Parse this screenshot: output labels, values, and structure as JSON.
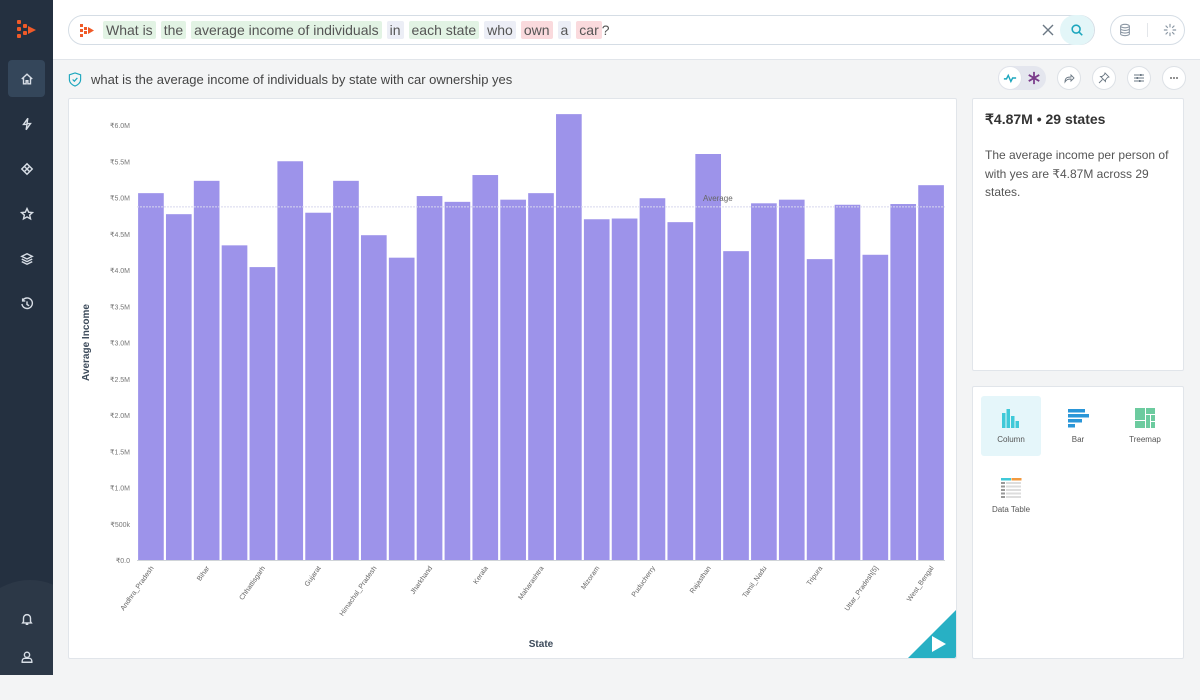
{
  "search": {
    "tokens": [
      {
        "text": "What is",
        "kind": "green"
      },
      {
        "text": "the",
        "kind": "green"
      },
      {
        "text": "average income of individuals",
        "kind": "green"
      },
      {
        "text": "in",
        "kind": "grey"
      },
      {
        "text": "each state",
        "kind": "green"
      },
      {
        "text": "who",
        "kind": "grey"
      },
      {
        "text": "own",
        "kind": "red"
      },
      {
        "text": "a",
        "kind": "grey"
      },
      {
        "text": "car",
        "kind": "red"
      },
      {
        "text": "?",
        "kind": "plain"
      }
    ]
  },
  "interpreted_query": "what is the average income of individuals by state with car ownership yes",
  "summary": {
    "headline": "₹4.87M • 29 states",
    "description": "The average income per person of with yes are ₹4.87M across 29 states."
  },
  "viz_options": [
    {
      "label": "Column",
      "icon": "column-chart-icon",
      "active": true
    },
    {
      "label": "Bar",
      "icon": "bar-chart-icon",
      "active": false
    },
    {
      "label": "Treemap",
      "icon": "treemap-icon",
      "active": false
    },
    {
      "label": "Data Table",
      "icon": "data-table-icon",
      "active": false
    }
  ],
  "colors": {
    "bar": "#9d93ea",
    "accent": "#28b0c4",
    "brand": "#f05a28",
    "sidebar": "#243040"
  },
  "chart_data": {
    "type": "bar",
    "title": "",
    "xlabel": "State",
    "ylabel": "Average Income",
    "ylim": [
      0,
      6000000
    ],
    "yticks": [
      0,
      500000,
      1000000,
      1500000,
      2000000,
      2500000,
      3000000,
      3500000,
      4000000,
      4500000,
      5000000,
      5500000,
      6000000
    ],
    "ytick_labels": [
      "₹0.0",
      "₹500k",
      "₹1.0M",
      "₹1.5M",
      "₹2.0M",
      "₹2.5M",
      "₹3.0M",
      "₹3.5M",
      "₹4.0M",
      "₹4.5M",
      "₹5.0M",
      "₹5.5M",
      "₹6.0M"
    ],
    "categories": [
      "Andhra_Pradesh",
      "",
      "Bihar",
      "",
      "Chhattisgarh",
      "",
      "Gujarat",
      "",
      "Himachal_Pradesh",
      "",
      "Jharkhand",
      "",
      "Kerala",
      "",
      "Maharashtra",
      "",
      "Mizoram",
      "",
      "Puducherry",
      "",
      "Rajasthan",
      "",
      "Tamil_Nadu",
      "",
      "Tripura",
      "",
      "Uttar_Pradesh[5]",
      "",
      "West_Bengal"
    ],
    "values": [
      5060000,
      4770000,
      5230000,
      4340000,
      4040000,
      5500000,
      4790000,
      5230000,
      4480000,
      4170000,
      5020000,
      4940000,
      5310000,
      4970000,
      5060000,
      6150000,
      4700000,
      4710000,
      4990000,
      4660000,
      5600000,
      4260000,
      4920000,
      4970000,
      4150000,
      4900000,
      4210000,
      4910000,
      5170000
    ],
    "reference_line": {
      "label": "Average",
      "value": 4870000
    },
    "grid": false,
    "legend": "none"
  }
}
